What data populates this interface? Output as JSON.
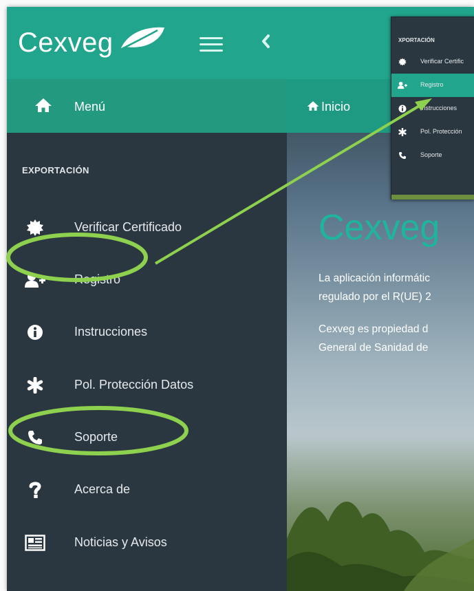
{
  "header": {
    "brand": "Cexveg",
    "colors": {
      "accent": "#21a58c",
      "highlight": "#8ed14e",
      "title": "#1fb59c"
    }
  },
  "subbar": {
    "menu_label": "Menú",
    "breadcrumb_label": "Inicio"
  },
  "sidebar": {
    "section_title": "EXPORTACIÓN",
    "items": [
      {
        "label": "Verificar Certificado",
        "icon": "certificate-icon"
      },
      {
        "label": "Registro",
        "icon": "user-plus-icon"
      },
      {
        "label": "Instrucciones",
        "icon": "info-icon"
      },
      {
        "label": "Pol. Protección Datos",
        "icon": "asterisk-icon"
      },
      {
        "label": "Soporte",
        "icon": "phone-icon"
      },
      {
        "label": "Acerca de",
        "icon": "question-icon"
      },
      {
        "label": "Noticias y Avisos",
        "icon": "newspaper-icon"
      }
    ]
  },
  "main": {
    "title": "Cexveg",
    "para1_line1": "La aplicación informátic",
    "para1_line2": "regulado por el R(UE) 2",
    "para2_line1": "Cexveg es propiedad d",
    "para2_line2": "General de Sanidad de"
  },
  "inset": {
    "section_title": "XPORTACIÓN",
    "items": [
      {
        "label": "Verificar Certific",
        "icon": "certificate-icon"
      },
      {
        "label": "Registro",
        "icon": "user-plus-icon",
        "active": true
      },
      {
        "label": "Instrucciones",
        "icon": "info-icon"
      },
      {
        "label": "Pol. Protección",
        "icon": "asterisk-icon"
      },
      {
        "label": "Soporte",
        "icon": "phone-icon"
      }
    ]
  }
}
